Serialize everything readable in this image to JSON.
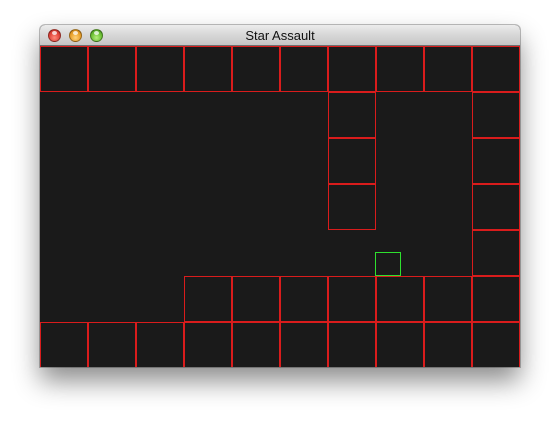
{
  "window": {
    "title": "Star Assault",
    "buttons": [
      "close",
      "minimize",
      "zoom"
    ]
  },
  "game": {
    "background_color": "#1a1a1a",
    "tile_color": "#d91c1c",
    "player_color": "#2ee02e",
    "grid": {
      "columns": 10,
      "rows": 7
    },
    "tiles": [
      {
        "col": 0,
        "row": 0
      },
      {
        "col": 1,
        "row": 0
      },
      {
        "col": 2,
        "row": 0
      },
      {
        "col": 3,
        "row": 0
      },
      {
        "col": 4,
        "row": 0
      },
      {
        "col": 5,
        "row": 0
      },
      {
        "col": 6,
        "row": 0
      },
      {
        "col": 7,
        "row": 0
      },
      {
        "col": 8,
        "row": 0
      },
      {
        "col": 9,
        "row": 0
      },
      {
        "col": 6,
        "row": 1
      },
      {
        "col": 9,
        "row": 1
      },
      {
        "col": 6,
        "row": 2
      },
      {
        "col": 9,
        "row": 2
      },
      {
        "col": 6,
        "row": 3
      },
      {
        "col": 9,
        "row": 3
      },
      {
        "col": 9,
        "row": 4
      },
      {
        "col": 3,
        "row": 5
      },
      {
        "col": 4,
        "row": 5
      },
      {
        "col": 5,
        "row": 5
      },
      {
        "col": 6,
        "row": 5
      },
      {
        "col": 7,
        "row": 5
      },
      {
        "col": 8,
        "row": 5
      },
      {
        "col": 9,
        "row": 5
      },
      {
        "col": 0,
        "row": 6
      },
      {
        "col": 1,
        "row": 6
      },
      {
        "col": 2,
        "row": 6
      },
      {
        "col": 3,
        "row": 6
      },
      {
        "col": 4,
        "row": 6
      },
      {
        "col": 5,
        "row": 6
      },
      {
        "col": 6,
        "row": 6
      },
      {
        "col": 7,
        "row": 6
      },
      {
        "col": 8,
        "row": 6
      },
      {
        "col": 9,
        "row": 6
      }
    ]
  }
}
